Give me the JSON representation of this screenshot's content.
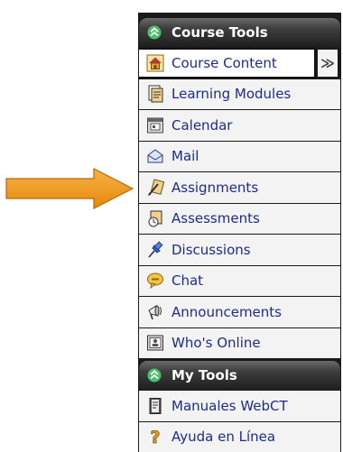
{
  "course_tools": {
    "title": "Course Tools",
    "collapse_glyph": "≫",
    "items": [
      {
        "label": "Course Content",
        "icon": "home-icon",
        "active": true
      },
      {
        "label": "Learning Modules",
        "icon": "modules-icon"
      },
      {
        "label": "Calendar",
        "icon": "calendar-icon"
      },
      {
        "label": "Mail",
        "icon": "mail-icon"
      },
      {
        "label": "Assignments",
        "icon": "assignments-icon"
      },
      {
        "label": "Assessments",
        "icon": "assessments-icon"
      },
      {
        "label": "Discussions",
        "icon": "pushpin-icon"
      },
      {
        "label": "Chat",
        "icon": "chat-bubble-icon"
      },
      {
        "label": "Announcements",
        "icon": "megaphone-icon"
      },
      {
        "label": "Who's Online",
        "icon": "who-online-icon"
      }
    ]
  },
  "my_tools": {
    "title": "My Tools",
    "items": [
      {
        "label": "Manuales WebCT",
        "icon": "manual-icon"
      },
      {
        "label": "Ayuda en Línea",
        "icon": "help-question-icon"
      }
    ]
  },
  "colors": {
    "arrow": "#f29a1c",
    "link_text": "#1d2c8c",
    "header_icon": "#4cbf6a"
  }
}
